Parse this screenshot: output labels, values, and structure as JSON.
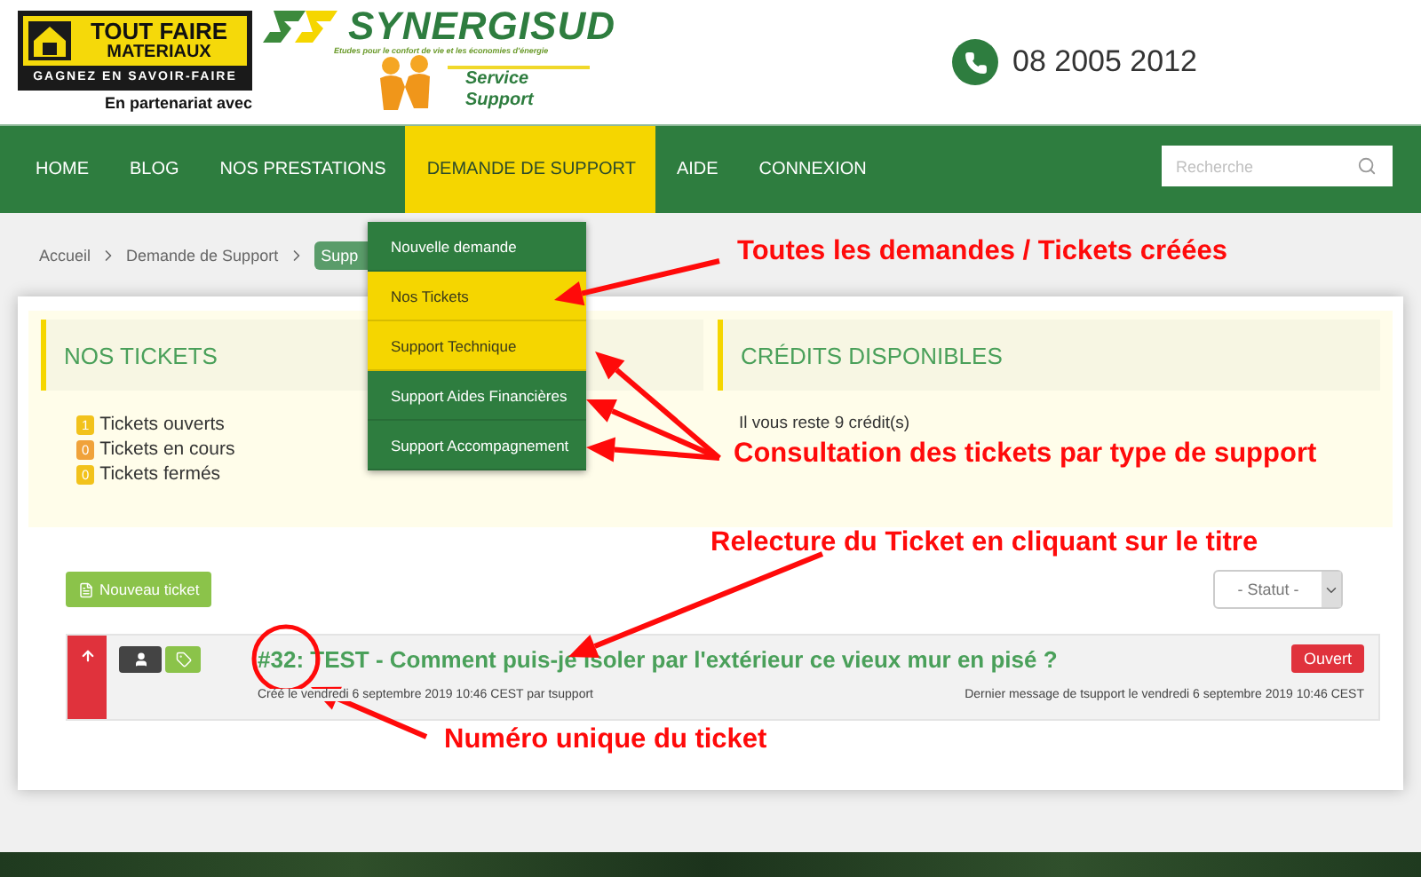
{
  "header": {
    "partner_logo": {
      "line_1": "TOUT FAIRE",
      "line_2": "MATERIAUX",
      "slogan": "GAGNEZ EN SAVOIR-FAIRE",
      "caption": "En partenariat avec"
    },
    "brand_logo": {
      "name": "SYNERGISUD",
      "tagline": "Etudes pour le confort de vie et les économies d'énergie",
      "service_1": "Service",
      "service_2": "Support"
    },
    "phone": "08 2005 2012"
  },
  "nav": {
    "items": [
      {
        "label": "HOME",
        "selected": false
      },
      {
        "label": "BLOG",
        "selected": false
      },
      {
        "label": "NOS PRESTATIONS",
        "selected": false
      },
      {
        "label": "DEMANDE DE SUPPORT",
        "selected": true
      },
      {
        "label": "AIDE",
        "selected": false
      },
      {
        "label": "CONNEXION",
        "selected": false
      }
    ],
    "search": {
      "placeholder": "Recherche"
    }
  },
  "breadcrumb": [
    {
      "label": "Accueil",
      "current": false
    },
    {
      "label": "Demande de Support",
      "current": false
    },
    {
      "label": "Supp",
      "current": true
    }
  ],
  "dropdown": {
    "items": [
      {
        "label": "Nouvelle demande",
        "highlighted": false
      },
      {
        "label": "Nos Tickets",
        "highlighted": true
      },
      {
        "label": "Support Technique",
        "highlighted": true
      },
      {
        "label": "Support Aides Financières",
        "highlighted": false
      },
      {
        "label": "Support Accompagnement",
        "highlighted": false
      }
    ]
  },
  "tickets_panel": {
    "title": "NOS TICKETS",
    "counts": [
      {
        "count": "1",
        "label": "Tickets ouverts",
        "color": "#f2c21b"
      },
      {
        "count": "0",
        "label": "Tickets en cours",
        "color": "#f0a23a"
      },
      {
        "count": "0",
        "label": "Tickets fermés",
        "color": "#f2c21b"
      }
    ]
  },
  "credits_panel": {
    "title": "CRÉDITS DISPONIBLES",
    "text": "Il vous reste 9 crédit(s)"
  },
  "new_ticket_button": "Nouveau ticket",
  "status_select": {
    "value": "- Statut -"
  },
  "tickets": [
    {
      "title": "#32: TEST - Comment puis-je isoler par l'extérieur ce vieux mur en pisé ?",
      "created": "Créé le vendredi 6 septembre 2019 10:46 CEST par tsupport",
      "last_message": "Dernier message de tsupport le vendredi 6 septembre 2019 10:46 CEST",
      "status": "Ouvert"
    }
  ],
  "annotations": [
    {
      "text": "Toutes les demandes / Tickets créées"
    },
    {
      "text": "Consultation des tickets par type de support"
    },
    {
      "text": "Relecture du Ticket en cliquant sur le titre"
    },
    {
      "text": "Numéro unique du ticket"
    }
  ]
}
